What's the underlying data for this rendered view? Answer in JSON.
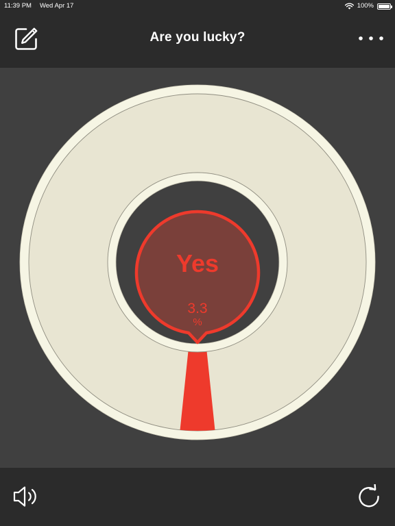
{
  "status_bar": {
    "time": "11:39 PM",
    "date": "Wed Apr 17",
    "battery": "100%",
    "battery_level": 1.0,
    "icons": [
      "wifi-icon",
      "battery-icon"
    ]
  },
  "nav": {
    "title": "Are you lucky?",
    "left_icon": "edit-icon",
    "right_icon": "more-icon"
  },
  "roulette": {
    "segments": [
      {
        "label": "Yes",
        "percent_value": "3.3",
        "percent_sign": "%",
        "fraction": 0.033
      }
    ],
    "colors": {
      "wheel_rim": "#f6f5e4",
      "wheel_face": "#e8e5d2",
      "segment": "#ee3a2c",
      "bubble_fill": "#7a403a",
      "hub_background": "#404040"
    }
  },
  "toolbar": {
    "left_icon": "speaker-icon",
    "right_icon": "refresh-icon"
  }
}
